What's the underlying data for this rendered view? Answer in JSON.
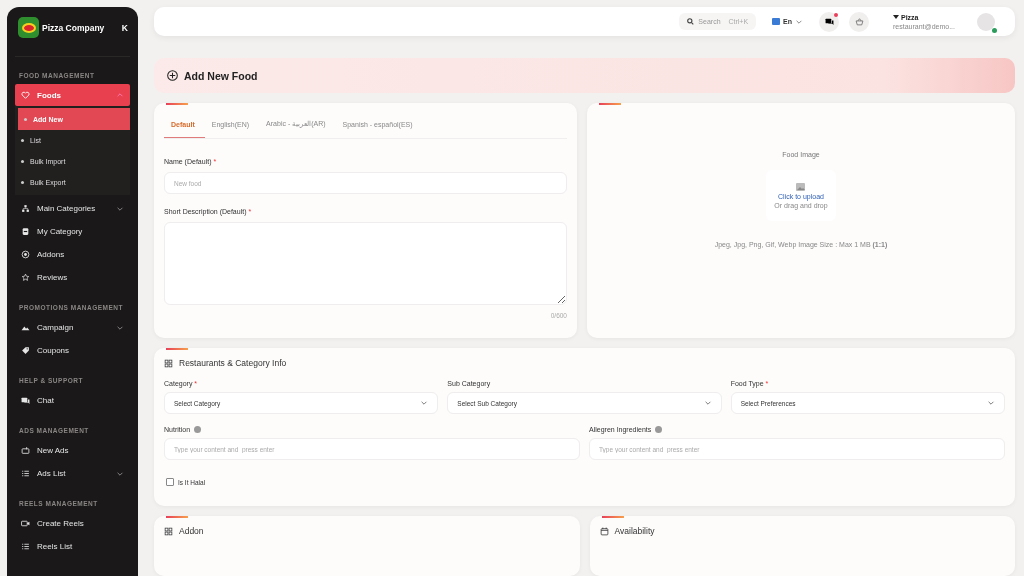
{
  "sidebar": {
    "brand": "Pizza Company",
    "collapse_key": "K",
    "sections": [
      {
        "title": "FOOD MANAGEMENT",
        "items": [
          {
            "label": "Foods",
            "kind": "heart",
            "selected": true,
            "expanded": true,
            "children": [
              {
                "label": "Add New",
                "selected": true
              },
              {
                "label": "List",
                "selected": false
              },
              {
                "label": "Bulk Import",
                "selected": false
              },
              {
                "label": "Bulk Export",
                "selected": false
              }
            ]
          },
          {
            "label": "Main Categories",
            "kind": "sitemap",
            "selected": false,
            "expanded": false
          },
          {
            "label": "My Category",
            "kind": "printer",
            "selected": false
          },
          {
            "label": "Addons",
            "kind": "circle",
            "selected": false
          },
          {
            "label": "Reviews",
            "kind": "star",
            "selected": false
          }
        ]
      },
      {
        "title": "PROMOTIONS MANAGEMENT",
        "items": [
          {
            "label": "Campaign",
            "kind": "mountain",
            "selected": false,
            "expanded": false
          },
          {
            "label": "Coupons",
            "kind": "tag",
            "selected": false
          }
        ]
      },
      {
        "title": "HELP & SUPPORT",
        "items": [
          {
            "label": "Chat",
            "kind": "chat",
            "selected": false
          }
        ]
      },
      {
        "title": "ADS MANAGEMENT",
        "items": [
          {
            "label": "New Ads",
            "kind": "ad",
            "selected": false
          },
          {
            "label": "Ads List",
            "kind": "list",
            "selected": false,
            "expanded": false
          }
        ]
      },
      {
        "title": "REELS MANAGEMENT",
        "items": [
          {
            "label": "Create Reels",
            "kind": "video",
            "selected": false
          },
          {
            "label": "Reels List",
            "kind": "list",
            "selected": false
          }
        ]
      }
    ]
  },
  "topbar": {
    "search": {
      "placeholder": "Search",
      "shortcut": "Ctrl+K"
    },
    "language": "En",
    "notification": true,
    "user": {
      "name": "Pizza",
      "email": "restaurant@demo...",
      "online": true
    }
  },
  "page_title": "Add New Food",
  "language_tabs": [
    {
      "label": "Default",
      "selected": true
    },
    {
      "label": "English(EN)",
      "selected": false
    },
    {
      "label": "Arabic - العربية(AR)",
      "selected": false
    },
    {
      "label": "Spanish - español(ES)",
      "selected": false
    }
  ],
  "name_field": {
    "label": "Name (Default)",
    "required_mark": "*",
    "placeholder": "New food"
  },
  "description_field": {
    "label": "Short Description (Default)",
    "required_mark": "*",
    "counter": "0/600"
  },
  "image_upload": {
    "title": "Food Image",
    "action": "Click to upload",
    "hint": "Or drag and drop",
    "note": "Jpeg, Jpg, Png, Gif, Webp Image Size : Max 1 MB",
    "ratio": "(1:1)"
  },
  "category_card": {
    "title": "Restaurants & Category Info",
    "selects": [
      {
        "label": "Category",
        "required_mark": "*",
        "value": "Select Category"
      },
      {
        "label": "Sub Category",
        "value": "Select Sub Category"
      },
      {
        "label": "Food Type",
        "required_mark": "*",
        "value": "Select Preferences"
      }
    ],
    "tag_fields": [
      {
        "label": "Nutrition",
        "placeholder": "Type your content and  press enter"
      },
      {
        "label": "Allegren Ingredients",
        "placeholder": "Type your content and  press enter"
      }
    ],
    "halal": {
      "label": "Is It Halal",
      "checked": false
    }
  },
  "bottom_cards": [
    {
      "title": "Addon",
      "kind": "grid"
    },
    {
      "title": "Availability",
      "kind": "calendar"
    }
  ]
}
